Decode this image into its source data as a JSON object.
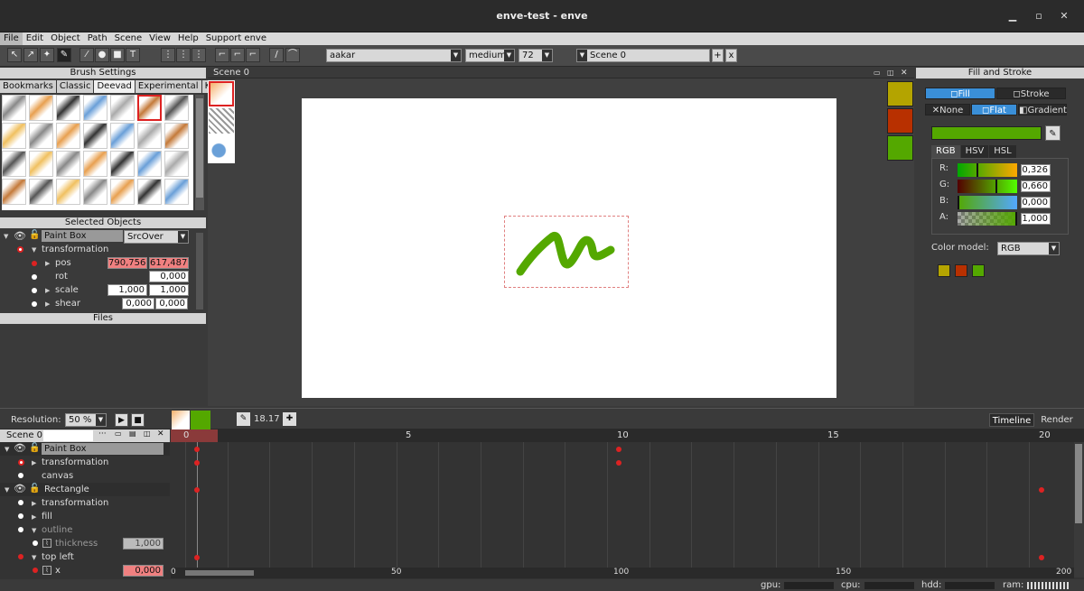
{
  "window": {
    "title": "enve-test - enve",
    "min_icon": "minimize-icon",
    "max_icon": "maximize-icon",
    "close_icon": "close-icon"
  },
  "menu": [
    "File",
    "Edit",
    "Object",
    "Path",
    "Scene",
    "View",
    "Help",
    "Support enve"
  ],
  "toolbar": {
    "font_combo": "aakar",
    "weight_combo": "medium",
    "size_combo": "72",
    "scene_combo": "Scene 0",
    "add": "+",
    "remove": "x"
  },
  "brush_settings": {
    "title": "Brush Settings",
    "tabs": [
      "Bookmarks",
      "Classic",
      "Deevad",
      "Experimental",
      "K..."
    ]
  },
  "selected_objects": {
    "title": "Selected Objects",
    "object": "Paint Box",
    "blend": "SrcOver",
    "transformation": "transformation",
    "pos": {
      "label": "pos",
      "x": "790,756",
      "y": "617,487"
    },
    "rot": {
      "label": "rot",
      "v": "0,000"
    },
    "scale": {
      "label": "scale",
      "x": "1,000",
      "y": "1,000"
    },
    "shear": {
      "label": "shear",
      "x": "0,000",
      "y": "0,000"
    }
  },
  "files": {
    "title": "Files"
  },
  "scene_view": {
    "title": "Scene 0"
  },
  "fill_stroke": {
    "title": "Fill and Stroke",
    "fill": "Fill",
    "stroke": "Stroke",
    "none": "None",
    "flat": "Flat",
    "gradient": "Gradient",
    "color_tabs": [
      "RGB",
      "HSV",
      "HSL"
    ],
    "r": {
      "label": "R:",
      "v": "0,326"
    },
    "g": {
      "label": "G:",
      "v": "0,660"
    },
    "b": {
      "label": "B:",
      "v": "0,000"
    },
    "a": {
      "label": "A:",
      "v": "1,000"
    },
    "color_model_label": "Color model:",
    "color_model": "RGB",
    "current_color": "#54a800",
    "swatches": [
      "#b4a400",
      "#b83000",
      "#54a800"
    ]
  },
  "bottom_bar": {
    "resolution_label": "Resolution:",
    "resolution": "50 %",
    "fps": "18.17",
    "timeline_tab": "Timeline",
    "render_tab": "Render"
  },
  "timeline": {
    "scene": "Scene 0",
    "ruler": [
      "0",
      "5",
      "10",
      "15",
      "20"
    ],
    "bottom_ruler": [
      "0",
      "50",
      "100",
      "150",
      "200"
    ],
    "rows": [
      {
        "label": "Paint Box",
        "type": "object",
        "indent": 0
      },
      {
        "label": "transformation",
        "type": "prop",
        "indent": 1
      },
      {
        "label": "canvas",
        "type": "leaf",
        "indent": 1
      },
      {
        "label": "Rectangle",
        "type": "object",
        "indent": 0
      },
      {
        "label": "transformation",
        "type": "prop",
        "indent": 1
      },
      {
        "label": "fill",
        "type": "prop",
        "indent": 1
      },
      {
        "label": "outline",
        "type": "prop",
        "indent": 1
      },
      {
        "label": "thickness",
        "type": "leaf",
        "indent": 2,
        "value": "1,000"
      },
      {
        "label": "top left",
        "type": "prop",
        "indent": 1
      },
      {
        "label": "x",
        "type": "leaf",
        "indent": 2,
        "value": "0,000"
      }
    ]
  },
  "status": {
    "gpu": "gpu:",
    "cpu": "cpu:",
    "hdd": "hdd:",
    "ram": "ram:"
  }
}
